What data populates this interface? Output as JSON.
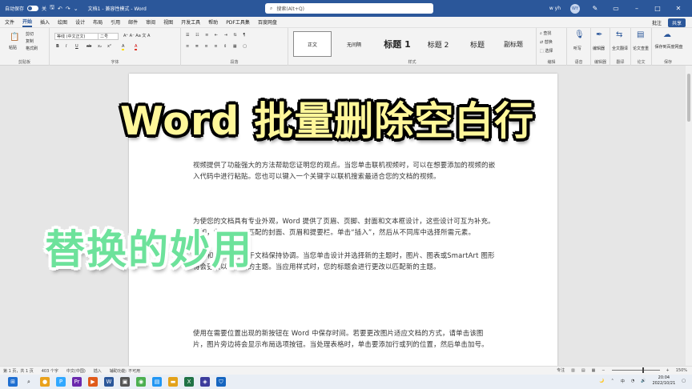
{
  "titlebar": {
    "autosave_label": "自动保存",
    "autosave_state": "关",
    "doc_title": "文档1 - 兼容性模式 - Word",
    "search_placeholder": "搜索(Alt+Q)",
    "user": "w yh",
    "avatar_initials": "WY"
  },
  "menubar": {
    "tabs": [
      "文件",
      "开始",
      "插入",
      "绘图",
      "设计",
      "布局",
      "引用",
      "邮件",
      "审阅",
      "视图",
      "开发工具",
      "帮助",
      "PDF工具集",
      "百度网盘"
    ],
    "active_tab": "开始",
    "comments_label": "批注",
    "share_label": "共享"
  },
  "ribbon": {
    "clipboard": {
      "label": "剪贴板",
      "paste": "粘贴",
      "cut": "剪切",
      "copy": "复制",
      "format_painter": "格式刷"
    },
    "font": {
      "label": "字体",
      "font_name": "等线 (中文正文)",
      "font_size": "二号",
      "buttons": [
        "B",
        "I",
        "U",
        "ab",
        "x₂",
        "x²",
        "A",
        "A"
      ]
    },
    "paragraph": {
      "label": "段落"
    },
    "styles": {
      "label": "样式",
      "items": [
        "正文",
        "无间隔",
        "标题 1",
        "标题 2",
        "标题",
        "副标题"
      ]
    },
    "editing": {
      "label": "编辑",
      "find": "查找",
      "replace": "替换",
      "select": "选择"
    },
    "voice": {
      "label": "语音",
      "dictate": "听写"
    },
    "editor": {
      "label": "编辑器",
      "name": "编辑器"
    },
    "translate": {
      "label": "翻译",
      "name": "全文翻译"
    },
    "comments": {
      "label": "论文",
      "name": "论文查重"
    },
    "save": {
      "label": "保存",
      "name": "保存到百度网盘"
    }
  },
  "document": {
    "paragraphs": [
      "视频提供了功能强大的方法帮助您证明您的观点。当您单击联机视频时，可以在想要添加的视频的嵌入代码中进行粘贴。您也可以键入一个关键字以联机搜索最适合您的文档的视频。",
      "为使您的文档具有专业外观，Word 提供了页眉、页脚、封面和文本框设计，这些设计可互为补充。例如，您可以添加匹配的封面、页眉和提要栏。单击“插入”，然后从不同库中选择所需元素。",
      "主题和样式也有助于文档保持协调。当您单击设计并选择新的主题时，图片、图表或SmartArt 图形将会更改以匹配新的主题。当应用样式时，您的标题会进行更改以匹配新的主题。",
      "使用在需要位置出现的新按钮在 Word 中保存时间。若要更改图片适应文档的方式，请单击该图片，图片旁边将会显示布局选项按钮。当处理表格时，单击要添加行或列的位置，然后单击加号。"
    ]
  },
  "overlay": {
    "title": "Word 批量删除空白行",
    "subtitle": "替换的妙用"
  },
  "statusbar": {
    "page": "第 1 页，共 1 页",
    "words": "403 个字",
    "language": "中文(中国)",
    "mode": "插入",
    "accessibility": "辅助功能: 不可用",
    "focus": "专注",
    "zoom": "150%"
  },
  "taskbar": {
    "time": "20:04",
    "date": "2022/10/21",
    "input": "中"
  },
  "colors": {
    "word_blue": "#2b579a",
    "title_fill": "#fff79a",
    "subtitle_fill": "#6de29b"
  }
}
